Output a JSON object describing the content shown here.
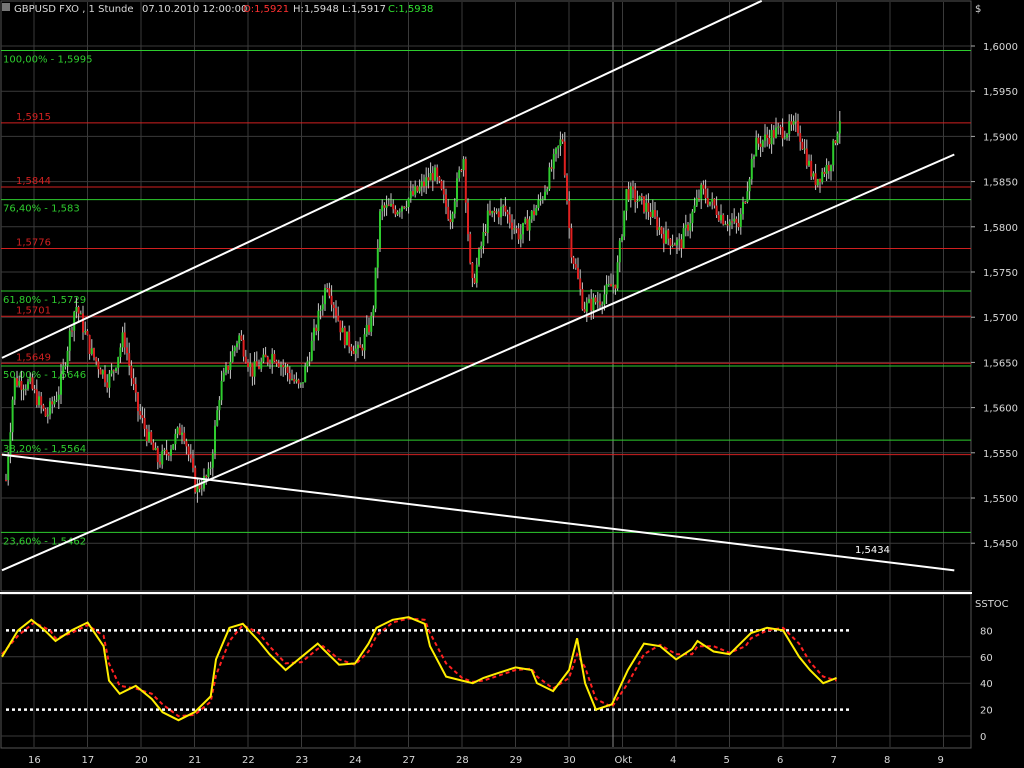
{
  "header": {
    "symbol": "GBPUSD FXO , 1 Stunde",
    "datetime": "07.10.2010 12:00:00",
    "open": "O:1,5921",
    "high": "H:1,5948",
    "low": "L:1,5917",
    "close": "C:1,5938"
  },
  "price_axis": {
    "unit": "$",
    "ticks": [
      "1,6000",
      "1,5950",
      "1,5900",
      "1,5850",
      "1,5800",
      "1,5750",
      "1,5700",
      "1,5650",
      "1,5600",
      "1,5550",
      "1,5500",
      "1,5450"
    ]
  },
  "oscillator": {
    "name": "SSTOC",
    "ticks": [
      "80",
      "60",
      "40",
      "20",
      "0"
    ],
    "levels": [
      80,
      20
    ]
  },
  "date_axis": [
    "16",
    "17",
    "20",
    "21",
    "22",
    "23",
    "24",
    "27",
    "28",
    "29",
    "30",
    "Okt",
    "4",
    "5",
    "6",
    "7",
    "8",
    "9"
  ],
  "colors": {
    "background": "#000000",
    "grid": "#3a3a3a",
    "up": "#2ecc2e",
    "down": "#e02020",
    "fib": "#2ecc2e",
    "resistance": "#d02020",
    "trend": "#ffffff",
    "stoch_k": "#ffee00",
    "stoch_d": "#ff2020"
  },
  "chart_data": {
    "type": "candlestick",
    "title": "GBPUSD FXO , 1 Stunde",
    "ylim": [
      1.5415,
      1.605
    ],
    "grid": true,
    "fib_levels": [
      {
        "label": "100,00% - 1,5995",
        "value": 1.5995
      },
      {
        "label": "76,40% - 1,583",
        "value": 1.583
      },
      {
        "label": "61,80% - 1,5729",
        "value": 1.5729
      },
      {
        "label": "50,00% - 1,5646",
        "value": 1.5646
      },
      {
        "label": "38,20% - 1,5564",
        "value": 1.5564
      },
      {
        "label": "23,60% - 1,5462",
        "value": 1.5462
      }
    ],
    "horizontal_levels": [
      {
        "label": "1,5915",
        "value": 1.5915
      },
      {
        "label": "1,5844",
        "value": 1.5844
      },
      {
        "label": "1,5776",
        "value": 1.5776
      },
      {
        "label": "1,5701",
        "value": 1.5701
      },
      {
        "label": "1,5649",
        "value": 1.5649
      },
      {
        "label": "",
        "value": 1.5548
      }
    ],
    "trendline_label": "1,5434",
    "price_path": [
      {
        "x": 0,
        "y": 1.552
      },
      {
        "x": 0.15,
        "y": 1.563
      },
      {
        "x": 0.45,
        "y": 1.5625
      },
      {
        "x": 0.75,
        "y": 1.559
      },
      {
        "x": 1,
        "y": 1.562
      },
      {
        "x": 1.3,
        "y": 1.5715
      },
      {
        "x": 1.6,
        "y": 1.566
      },
      {
        "x": 1.9,
        "y": 1.563
      },
      {
        "x": 2,
        "y": 1.564
      },
      {
        "x": 2.2,
        "y": 1.568
      },
      {
        "x": 2.45,
        "y": 1.56
      },
      {
        "x": 2.7,
        "y": 1.556
      },
      {
        "x": 2.85,
        "y": 1.554
      },
      {
        "x": 3,
        "y": 1.555
      },
      {
        "x": 3.3,
        "y": 1.558
      },
      {
        "x": 3.55,
        "y": 1.551
      },
      {
        "x": 3.8,
        "y": 1.5525
      },
      {
        "x": 4,
        "y": 1.562
      },
      {
        "x": 4.35,
        "y": 1.568
      },
      {
        "x": 4.6,
        "y": 1.564
      },
      {
        "x": 5,
        "y": 1.566
      },
      {
        "x": 5.25,
        "y": 1.564
      },
      {
        "x": 5.5,
        "y": 1.562
      },
      {
        "x": 5.8,
        "y": 1.569
      },
      {
        "x": 6,
        "y": 1.574
      },
      {
        "x": 6.3,
        "y": 1.568
      },
      {
        "x": 6.6,
        "y": 1.566
      },
      {
        "x": 6.85,
        "y": 1.57
      },
      {
        "x": 7,
        "y": 1.582
      },
      {
        "x": 7.3,
        "y": 1.582
      },
      {
        "x": 7.7,
        "y": 1.584
      },
      {
        "x": 8,
        "y": 1.586
      },
      {
        "x": 8.3,
        "y": 1.581
      },
      {
        "x": 8.55,
        "y": 1.588
      },
      {
        "x": 8.7,
        "y": 1.573
      },
      {
        "x": 9,
        "y": 1.581
      },
      {
        "x": 9.3,
        "y": 1.582
      },
      {
        "x": 9.6,
        "y": 1.579
      },
      {
        "x": 10,
        "y": 1.583
      },
      {
        "x": 10.4,
        "y": 1.59
      },
      {
        "x": 10.55,
        "y": 1.578
      },
      {
        "x": 10.8,
        "y": 1.571
      },
      {
        "x": 11.1,
        "y": 1.572
      },
      {
        "x": 11.4,
        "y": 1.574
      },
      {
        "x": 11.6,
        "y": 1.584
      },
      {
        "x": 12,
        "y": 1.582
      },
      {
        "x": 12.3,
        "y": 1.579
      },
      {
        "x": 12.6,
        "y": 1.578
      },
      {
        "x": 13,
        "y": 1.584
      },
      {
        "x": 13.4,
        "y": 1.581
      },
      {
        "x": 13.7,
        "y": 1.58
      },
      {
        "x": 14,
        "y": 1.589
      },
      {
        "x": 14.4,
        "y": 1.5905
      },
      {
        "x": 14.8,
        "y": 1.591
      },
      {
        "x": 15.1,
        "y": 1.585
      },
      {
        "x": 15.4,
        "y": 1.587
      },
      {
        "x": 15.6,
        "y": 1.5925
      }
    ],
    "channel_upper": {
      "x1": 0,
      "y1": 1.5655,
      "x2": 14.2,
      "y2": 1.605
    },
    "channel_lower": {
      "x1": 0,
      "y1": 1.542,
      "x2": 17.8,
      "y2": 1.588
    },
    "descending_line": {
      "x1": 0,
      "y1": 1.5548,
      "x2": 17.8,
      "y2": 1.542
    },
    "stochastic_k": [
      {
        "x": 0,
        "y": 60
      },
      {
        "x": 0.3,
        "y": 80
      },
      {
        "x": 0.55,
        "y": 88
      },
      {
        "x": 0.8,
        "y": 80
      },
      {
        "x": 1,
        "y": 72
      },
      {
        "x": 1.3,
        "y": 80
      },
      {
        "x": 1.6,
        "y": 86
      },
      {
        "x": 1.9,
        "y": 68
      },
      {
        "x": 2,
        "y": 42
      },
      {
        "x": 2.2,
        "y": 32
      },
      {
        "x": 2.5,
        "y": 38
      },
      {
        "x": 2.8,
        "y": 28
      },
      {
        "x": 3,
        "y": 18
      },
      {
        "x": 3.3,
        "y": 12
      },
      {
        "x": 3.6,
        "y": 18
      },
      {
        "x": 3.9,
        "y": 30
      },
      {
        "x": 4,
        "y": 58
      },
      {
        "x": 4.25,
        "y": 82
      },
      {
        "x": 4.5,
        "y": 85
      },
      {
        "x": 4.8,
        "y": 72
      },
      {
        "x": 5,
        "y": 62
      },
      {
        "x": 5.3,
        "y": 50
      },
      {
        "x": 5.6,
        "y": 60
      },
      {
        "x": 5.9,
        "y": 70
      },
      {
        "x": 6,
        "y": 66
      },
      {
        "x": 6.3,
        "y": 54
      },
      {
        "x": 6.6,
        "y": 55
      },
      {
        "x": 6.85,
        "y": 70
      },
      {
        "x": 7,
        "y": 82
      },
      {
        "x": 7.3,
        "y": 88
      },
      {
        "x": 7.6,
        "y": 90
      },
      {
        "x": 7.9,
        "y": 85
      },
      {
        "x": 8,
        "y": 68
      },
      {
        "x": 8.3,
        "y": 45
      },
      {
        "x": 8.6,
        "y": 42
      },
      {
        "x": 8.8,
        "y": 40
      },
      {
        "x": 9,
        "y": 44
      },
      {
        "x": 9.3,
        "y": 48
      },
      {
        "x": 9.6,
        "y": 52
      },
      {
        "x": 9.9,
        "y": 50
      },
      {
        "x": 10,
        "y": 40
      },
      {
        "x": 10.3,
        "y": 34
      },
      {
        "x": 10.6,
        "y": 50
      },
      {
        "x": 10.75,
        "y": 74
      },
      {
        "x": 10.9,
        "y": 40
      },
      {
        "x": 11.1,
        "y": 20
      },
      {
        "x": 11.4,
        "y": 24
      },
      {
        "x": 11.7,
        "y": 50
      },
      {
        "x": 12,
        "y": 70
      },
      {
        "x": 12.3,
        "y": 68
      },
      {
        "x": 12.6,
        "y": 58
      },
      {
        "x": 12.9,
        "y": 66
      },
      {
        "x": 13,
        "y": 72
      },
      {
        "x": 13.3,
        "y": 64
      },
      {
        "x": 13.6,
        "y": 62
      },
      {
        "x": 13.9,
        "y": 74
      },
      {
        "x": 14,
        "y": 78
      },
      {
        "x": 14.3,
        "y": 82
      },
      {
        "x": 14.6,
        "y": 80
      },
      {
        "x": 14.9,
        "y": 60
      },
      {
        "x": 15.1,
        "y": 50
      },
      {
        "x": 15.35,
        "y": 40
      },
      {
        "x": 15.6,
        "y": 44
      }
    ],
    "stochastic_d": [
      {
        "x": 0,
        "y": 62
      },
      {
        "x": 0.3,
        "y": 76
      },
      {
        "x": 0.6,
        "y": 86
      },
      {
        "x": 0.9,
        "y": 80
      },
      {
        "x": 1,
        "y": 74
      },
      {
        "x": 1.3,
        "y": 78
      },
      {
        "x": 1.6,
        "y": 84
      },
      {
        "x": 1.9,
        "y": 76
      },
      {
        "x": 2,
        "y": 55
      },
      {
        "x": 2.2,
        "y": 38
      },
      {
        "x": 2.5,
        "y": 36
      },
      {
        "x": 2.8,
        "y": 32
      },
      {
        "x": 3,
        "y": 24
      },
      {
        "x": 3.3,
        "y": 15
      },
      {
        "x": 3.6,
        "y": 16
      },
      {
        "x": 3.9,
        "y": 26
      },
      {
        "x": 4,
        "y": 46
      },
      {
        "x": 4.25,
        "y": 72
      },
      {
        "x": 4.5,
        "y": 84
      },
      {
        "x": 4.8,
        "y": 78
      },
      {
        "x": 5,
        "y": 68
      },
      {
        "x": 5.3,
        "y": 55
      },
      {
        "x": 5.6,
        "y": 56
      },
      {
        "x": 5.9,
        "y": 66
      },
      {
        "x": 6,
        "y": 68
      },
      {
        "x": 6.3,
        "y": 58
      },
      {
        "x": 6.6,
        "y": 54
      },
      {
        "x": 6.85,
        "y": 64
      },
      {
        "x": 7,
        "y": 76
      },
      {
        "x": 7.3,
        "y": 86
      },
      {
        "x": 7.6,
        "y": 89
      },
      {
        "x": 7.9,
        "y": 88
      },
      {
        "x": 8,
        "y": 78
      },
      {
        "x": 8.3,
        "y": 55
      },
      {
        "x": 8.6,
        "y": 44
      },
      {
        "x": 8.8,
        "y": 41
      },
      {
        "x": 9,
        "y": 42
      },
      {
        "x": 9.3,
        "y": 46
      },
      {
        "x": 9.6,
        "y": 50
      },
      {
        "x": 9.9,
        "y": 51
      },
      {
        "x": 10,
        "y": 45
      },
      {
        "x": 10.3,
        "y": 36
      },
      {
        "x": 10.6,
        "y": 44
      },
      {
        "x": 10.75,
        "y": 62
      },
      {
        "x": 10.9,
        "y": 52
      },
      {
        "x": 11.1,
        "y": 28
      },
      {
        "x": 11.4,
        "y": 22
      },
      {
        "x": 11.7,
        "y": 40
      },
      {
        "x": 12,
        "y": 62
      },
      {
        "x": 12.3,
        "y": 69
      },
      {
        "x": 12.6,
        "y": 62
      },
      {
        "x": 12.9,
        "y": 62
      },
      {
        "x": 13,
        "y": 68
      },
      {
        "x": 13.3,
        "y": 68
      },
      {
        "x": 13.6,
        "y": 63
      },
      {
        "x": 13.9,
        "y": 68
      },
      {
        "x": 14,
        "y": 74
      },
      {
        "x": 14.3,
        "y": 80
      },
      {
        "x": 14.6,
        "y": 82
      },
      {
        "x": 14.9,
        "y": 70
      },
      {
        "x": 15.1,
        "y": 56
      },
      {
        "x": 15.35,
        "y": 45
      },
      {
        "x": 15.6,
        "y": 42
      }
    ]
  }
}
